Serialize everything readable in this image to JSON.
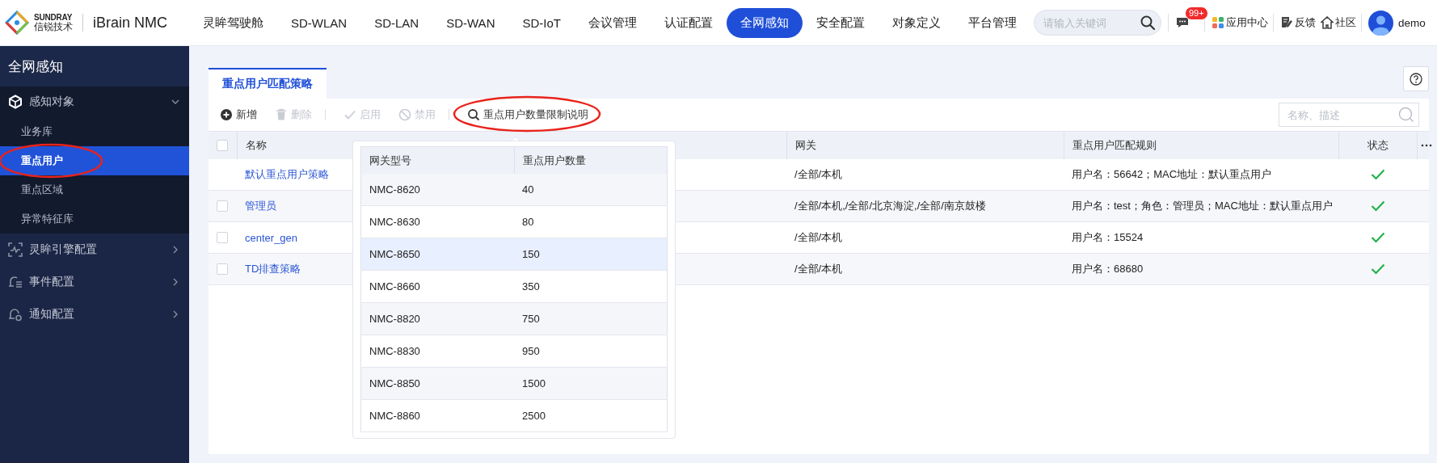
{
  "header": {
    "logo_brand": "SUNDRAY",
    "logo_company": "信锐技术",
    "product": "iBrain NMC",
    "nav": [
      {
        "label": "灵眸驾驶舱",
        "selected": false
      },
      {
        "label": "SD-WLAN",
        "selected": false
      },
      {
        "label": "SD-LAN",
        "selected": false
      },
      {
        "label": "SD-WAN",
        "selected": false
      },
      {
        "label": "SD-IoT",
        "selected": false
      },
      {
        "label": "会议管理",
        "selected": false
      },
      {
        "label": "认证配置",
        "selected": false
      },
      {
        "label": "全网感知",
        "selected": true
      },
      {
        "label": "安全配置",
        "selected": false
      },
      {
        "label": "对象定义",
        "selected": false
      },
      {
        "label": "平台管理",
        "selected": false
      }
    ],
    "search": {
      "placeholder": "请输入关键词"
    },
    "message_badge": "99+",
    "links": [
      {
        "kind": "apps",
        "label": "应用中心"
      },
      {
        "kind": "feedback",
        "label": "反馈"
      },
      {
        "kind": "community",
        "label": "社区"
      }
    ],
    "user": "demo"
  },
  "sidebar": {
    "title": "全网感知",
    "items": [
      {
        "kind": "cube",
        "label": "感知对象",
        "expanded": true,
        "children": [
          {
            "label": "业务库",
            "selected": false,
            "circled": false
          },
          {
            "label": "重点用户",
            "selected": true,
            "circled": true
          },
          {
            "label": "重点区域",
            "selected": false,
            "circled": false
          },
          {
            "label": "异常特征库",
            "selected": false,
            "circled": false
          }
        ]
      },
      {
        "kind": "scan",
        "label": "灵眸引擎配置",
        "expanded": false
      },
      {
        "kind": "event",
        "label": "事件配置",
        "expanded": false
      },
      {
        "kind": "notice",
        "label": "通知配置",
        "expanded": false
      }
    ]
  },
  "tabs": [
    {
      "label": "重点用户匹配策略",
      "selected": true
    }
  ],
  "toolbar": {
    "buttons": [
      {
        "kind": "add",
        "label": "新增",
        "disabled": false,
        "circled": false
      },
      {
        "kind": "delete",
        "label": "删除",
        "disabled": true,
        "circled": false
      },
      {
        "kind": "enable",
        "label": "启用",
        "disabled": true,
        "circled": false
      },
      {
        "kind": "disable",
        "label": "禁用",
        "disabled": true,
        "circled": false
      },
      {
        "kind": "info",
        "label": "重点用户数量限制说明",
        "disabled": false,
        "circled": true
      }
    ],
    "search": {
      "placeholder": "名称、描述"
    }
  },
  "table": {
    "select_all_checked": false,
    "columns": [
      "名称",
      "网关",
      "重点用户匹配规则",
      "状态"
    ],
    "rows": [
      {
        "kind": "default",
        "name": "默认重点用户策略",
        "gateway": "/全部/本机",
        "rule": "用户名：56642；MAC地址：默认重点用户",
        "enabled": true
      },
      {
        "kind": "custom",
        "checked": false,
        "name": "管理员",
        "gateway": "/全部/本机,/全部/北京海淀,/全部/南京鼓楼",
        "rule": "用户名：test；角色：管理员；MAC地址：默认重点用户",
        "enabled": true
      },
      {
        "kind": "custom",
        "checked": false,
        "name": "center_gen",
        "gateway": "/全部/本机",
        "rule": "用户名：15524",
        "enabled": true
      },
      {
        "kind": "custom",
        "checked": false,
        "name": "TD排查策略",
        "gateway": "/全部/本机",
        "rule": "用户名：68680",
        "enabled": true
      }
    ]
  },
  "popover": {
    "columns": [
      "网关型号",
      "重点用户数量"
    ],
    "rows": [
      {
        "model": "NMC-8620",
        "count": "40",
        "selected": false
      },
      {
        "model": "NMC-8630",
        "count": "80",
        "selected": false
      },
      {
        "model": "NMC-8650",
        "count": "150",
        "selected": true
      },
      {
        "model": "NMC-8660",
        "count": "350",
        "selected": false
      },
      {
        "model": "NMC-8820",
        "count": "750",
        "selected": false
      },
      {
        "model": "NMC-8830",
        "count": "950",
        "selected": false
      },
      {
        "model": "NMC-8850",
        "count": "1500",
        "selected": false
      },
      {
        "model": "NMC-8860",
        "count": "2500",
        "selected": false
      }
    ]
  }
}
